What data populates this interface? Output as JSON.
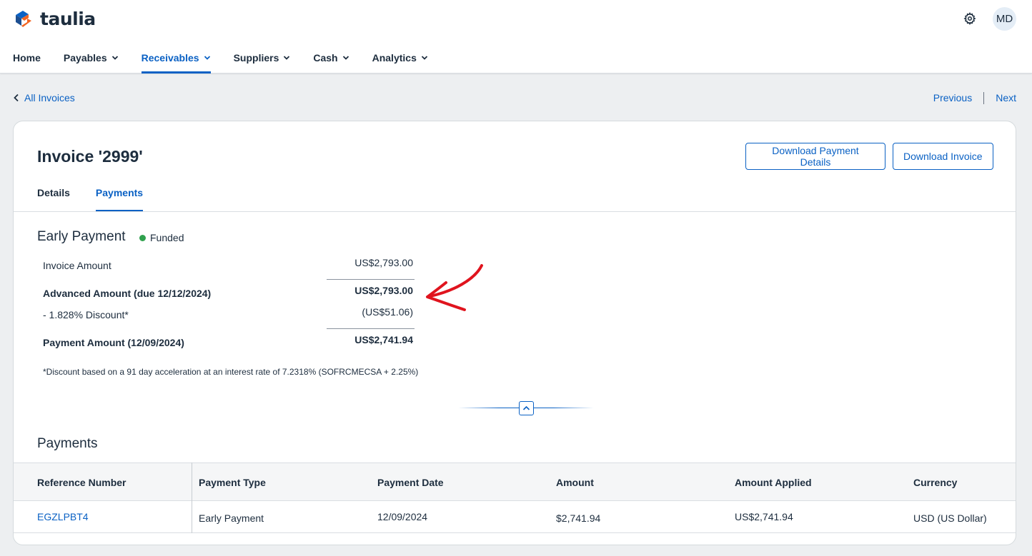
{
  "app": {
    "logo_text": "taulia",
    "user_initials": "MD",
    "brand_color": "#0a61c4",
    "logo_orange": "#f26522"
  },
  "nav": {
    "items": [
      {
        "label": "Home",
        "dropdown": false,
        "active": false
      },
      {
        "label": "Payables",
        "dropdown": true,
        "active": false
      },
      {
        "label": "Receivables",
        "dropdown": true,
        "active": true
      },
      {
        "label": "Suppliers",
        "dropdown": true,
        "active": false
      },
      {
        "label": "Cash",
        "dropdown": true,
        "active": false
      },
      {
        "label": "Analytics",
        "dropdown": true,
        "active": false
      }
    ]
  },
  "breadcrumb": {
    "back_label": "All Invoices",
    "previous_label": "Previous",
    "next_label": "Next"
  },
  "invoice": {
    "title": "Invoice '2999'",
    "download_payment_details": "Download Payment Details",
    "download_invoice": "Download Invoice",
    "tabs": [
      {
        "label": "Details",
        "active": false
      },
      {
        "label": "Payments",
        "active": true
      }
    ]
  },
  "early_payment": {
    "title": "Early Payment",
    "status": "Funded",
    "status_color": "#30a14e",
    "invoice_amount_label": "Invoice Amount",
    "invoice_amount_value": "US$2,793.00",
    "advanced_amount_label": "Advanced Amount (due 12/12/2024)",
    "advanced_amount_value": "US$2,793.00",
    "discount_label": "- 1.828% Discount*",
    "discount_value": "(US$51.06)",
    "payment_amount_label": "Payment Amount (12/09/2024)",
    "payment_amount_value": "US$2,741.94",
    "footnote": "*Discount based on a 91 day acceleration at an interest rate of 7.2318% (SOFRCMECSA + 2.25%)"
  },
  "payments": {
    "title": "Payments",
    "columns": [
      "Reference Number",
      "Payment Type",
      "Payment Date",
      "Amount",
      "Amount Applied",
      "Currency"
    ],
    "rows": [
      [
        "EGZLPBT4",
        "Early Payment",
        "12/09/2024",
        "$2,741.94",
        "US$2,741.94",
        "USD (US Dollar)"
      ]
    ]
  },
  "annotation": {
    "arrow_color": "#e0141e"
  }
}
